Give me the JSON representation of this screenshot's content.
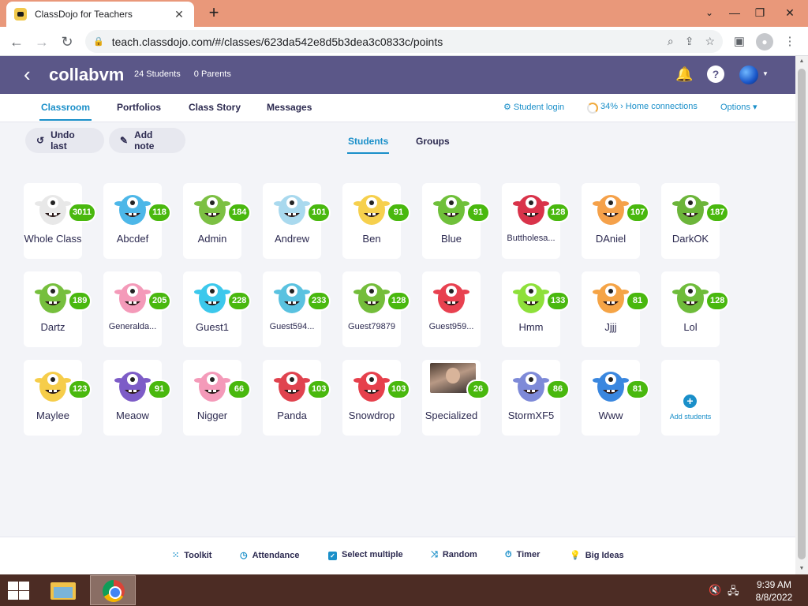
{
  "browser": {
    "tab_title": "ClassDojo for Teachers",
    "tab_close": "✕",
    "new_tab": "+",
    "url": "teach.classdojo.com/#/classes/623da542e8d5b3dea3c0833c/points"
  },
  "header": {
    "back": "‹",
    "class_name": "collabvm",
    "students_count": "24 Students",
    "parents_count": "0 Parents"
  },
  "nav": {
    "tabs": [
      "Classroom",
      "Portfolios",
      "Class Story",
      "Messages"
    ],
    "student_login": "Student login",
    "home_connections": "34% › Home connections",
    "options": "Options ▾"
  },
  "controls": {
    "undo_last": "Undo last",
    "add_note": "Add note",
    "view_students": "Students",
    "view_groups": "Groups"
  },
  "students": [
    {
      "name": "Whole Class",
      "points": "3011"
    },
    {
      "name": "Abcdef",
      "points": "118"
    },
    {
      "name": "Admin",
      "points": "184"
    },
    {
      "name": "Andrew",
      "points": "101"
    },
    {
      "name": "Ben",
      "points": "91"
    },
    {
      "name": "Blue",
      "points": "91"
    },
    {
      "name": "Buttholesa...",
      "points": "128"
    },
    {
      "name": "DAniel",
      "points": "107"
    },
    {
      "name": "DarkOK",
      "points": "187"
    },
    {
      "name": "Dartz",
      "points": "189"
    },
    {
      "name": "Generalda...",
      "points": "205"
    },
    {
      "name": "Guest1",
      "points": "228"
    },
    {
      "name": "Guest594...",
      "points": "233"
    },
    {
      "name": "Guest79879",
      "points": "128"
    },
    {
      "name": "Guest959...",
      "points": ""
    },
    {
      "name": "Hmm",
      "points": "133"
    },
    {
      "name": "Jjjj",
      "points": "81"
    },
    {
      "name": "Lol",
      "points": "128"
    },
    {
      "name": "Maylee",
      "points": "123"
    },
    {
      "name": "Meaow",
      "points": "91"
    },
    {
      "name": "Nigger",
      "points": "66"
    },
    {
      "name": "Panda",
      "points": "103"
    },
    {
      "name": "Snowdrop",
      "points": "103"
    },
    {
      "name": "Specialized",
      "points": "26"
    },
    {
      "name": "StormXF5",
      "points": "86"
    },
    {
      "name": "Www",
      "points": "81"
    }
  ],
  "add_students": "Add students",
  "toolbar": {
    "toolkit": "Toolkit",
    "attendance": "Attendance",
    "select_multiple": "Select multiple",
    "random": "Random",
    "timer": "Timer",
    "big_ideas": "Big Ideas"
  },
  "taskbar": {
    "time": "9:39 AM",
    "date": "8/8/2022"
  },
  "colors": {
    "header_purple": "#5b5788",
    "accent_blue": "#1a8fc9",
    "points_green": "#49b80e",
    "monster_colors": [
      "#e8e8e8",
      "#4db7e8",
      "#7cc043",
      "#a9d9ee",
      "#f6d04d",
      "#6fc03a",
      "#d9334a",
      "#f5a14a",
      "#6cb53a",
      "#76bf3d",
      "#f49ab9",
      "#3cc8ec",
      "#5ac2e0",
      "#74bd3b",
      "#e84150",
      "#8ee03a",
      "#f5a446",
      "#6fbc3b",
      "#f6cd4a",
      "#7d5cc7",
      "#f49ab9",
      "#e0434f",
      "#e6404c",
      "#000000",
      "#7e8ad8",
      "#3a87df"
    ]
  }
}
